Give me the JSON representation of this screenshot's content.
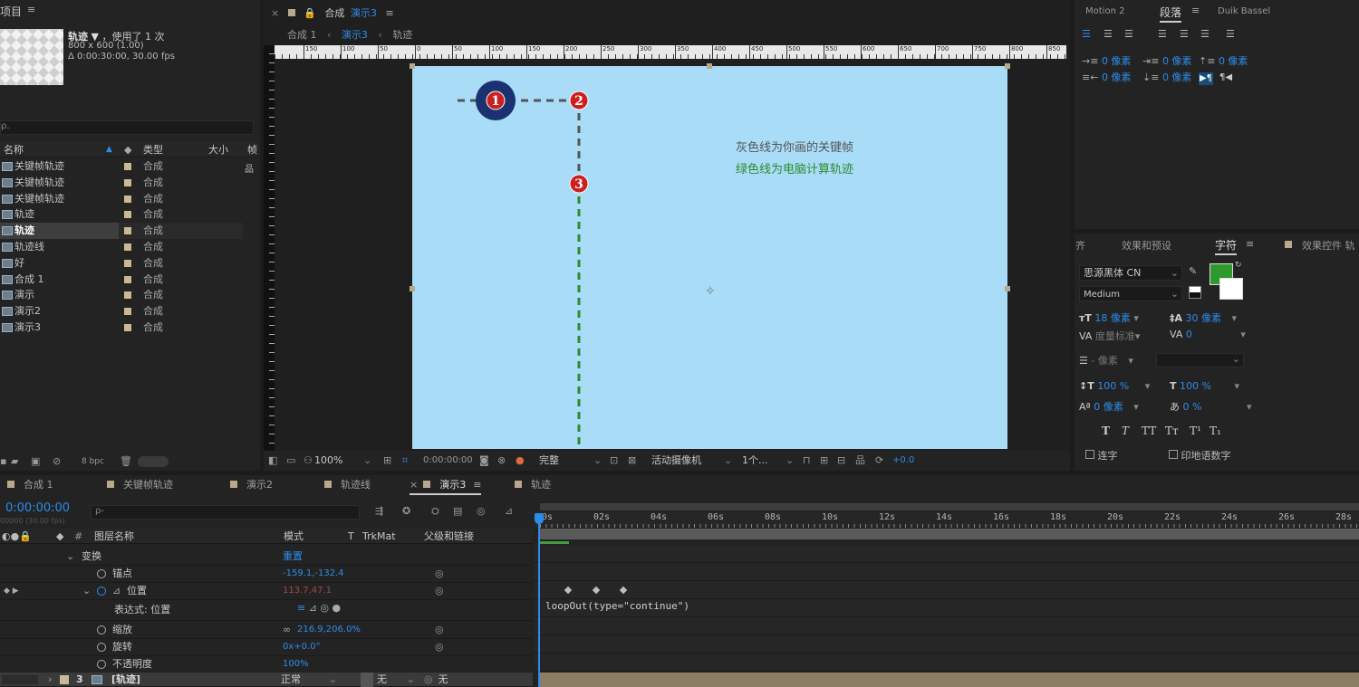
{
  "project": {
    "title": "项目",
    "selected_name": "轨迹",
    "used_text": "，使用了 1 次",
    "dims": "800 x 600 (1.00)",
    "duration": "Δ 0:00:30:00, 30.00 fps",
    "columns": {
      "name": "名称",
      "type": "类型",
      "size": "大小",
      "frame": "帧"
    },
    "items": [
      {
        "name": "关键帧轨迹",
        "type": "合成"
      },
      {
        "name": "关键帧轨迹",
        "type": "合成"
      },
      {
        "name": "关键帧轨迹",
        "type": "合成"
      },
      {
        "name": "轨迹",
        "type": "合成"
      },
      {
        "name": "轨迹",
        "type": "合成",
        "selected": true
      },
      {
        "name": "轨迹线",
        "type": "合成"
      },
      {
        "name": "好",
        "type": "合成"
      },
      {
        "name": "合成 1",
        "type": "合成"
      },
      {
        "name": "演示",
        "type": "合成"
      },
      {
        "name": "演示2",
        "type": "合成"
      },
      {
        "name": "演示3",
        "type": "合成"
      }
    ],
    "bpc": "8 bpc"
  },
  "comp_viewer": {
    "title_prefix": "合成",
    "title_active": "演示3",
    "breadcrumbs": [
      "合成 1",
      "演示3",
      "轨迹"
    ],
    "ruler_labels": [
      "150",
      "100",
      "50",
      "0",
      "50",
      "100",
      "150",
      "200",
      "250",
      "300",
      "350",
      "400",
      "450",
      "500",
      "550",
      "600",
      "650",
      "700",
      "750",
      "800",
      "850"
    ],
    "annotation_gray": "灰色线为你画的关键帧",
    "annotation_green": "绿色线为电脑计算轨迹",
    "markers": [
      "1",
      "2",
      "3"
    ],
    "zoom": "100%",
    "timecode": "0:00:00:00",
    "quality": "完整",
    "camera": "活动摄像机",
    "views": "1个...",
    "exposure": "+0.0",
    "colors": {
      "canvas": "#a9dcf7",
      "gray_line": "#555555",
      "green_line": "#2e8b2e",
      "marker": "#cc1f1f",
      "marker_ring": "#1c3270"
    }
  },
  "paragraph": {
    "tabs": [
      "Motion 2",
      "段落",
      "Duik Bassel"
    ],
    "active_tab": "段落",
    "fields": [
      "0 像素",
      "0 像素",
      "0 像素",
      "0 像素",
      "0 像素"
    ]
  },
  "character": {
    "tabs": [
      "齐",
      "效果和预设",
      "字符",
      "效果控件 轨"
    ],
    "active_tab": "字符",
    "font_family": "思源黑体 CN",
    "font_style": "Medium",
    "font_size": "18 像素",
    "leading": "30 像素",
    "kerning": "度量标准",
    "tracking": "0",
    "stroke": "- 像素",
    "vscale": "100 %",
    "hscale": "100 %",
    "baseline": "0 像素",
    "tsume": "0 %",
    "style_buttons": [
      "T",
      "T",
      "TT",
      "Tт",
      "T¹",
      "T₁"
    ],
    "ligature": "连字",
    "hindi_digits": "印地语数字",
    "fill_color": "#2e9a2e"
  },
  "timeline": {
    "tabs": [
      "合成 1",
      "关键帧轨迹",
      "演示2",
      "轨迹线",
      "演示3",
      "轨迹"
    ],
    "active_tab": "演示3",
    "timecode": "0:00:00:00",
    "fps_sub": "00000 (30.00 fps)",
    "search_placeholder": "ρ-",
    "col_layer_name": "图层名称",
    "col_mode": "模式",
    "col_t": "T",
    "col_trkmat": "TrkMat",
    "col_parent": "父级和链接",
    "rows": {
      "transform": "变换",
      "transform_value": "重置",
      "anchor": "锚点",
      "anchor_value": "-159.1,-132.4",
      "position": "位置",
      "position_value": "113.7,47.1",
      "expression_label": "表达式: 位置",
      "scale": "缩放",
      "scale_value": "216.9,206.0%",
      "rotation": "旋转",
      "rotation_value": "0x+0.0°",
      "opacity": "不透明度",
      "opacity_value": "100%"
    },
    "layer": {
      "num": "3",
      "name": "[轨迹]",
      "mode": "正常",
      "trkmat": "无",
      "parent": "无"
    },
    "expression": "loopOut(type=\"continue\")",
    "time_labels": [
      "00s",
      "02s",
      "04s",
      "06s",
      "08s",
      "10s",
      "12s",
      "14s",
      "16s",
      "18s",
      "20s",
      "22s",
      "24s",
      "26s",
      "28s"
    ]
  }
}
